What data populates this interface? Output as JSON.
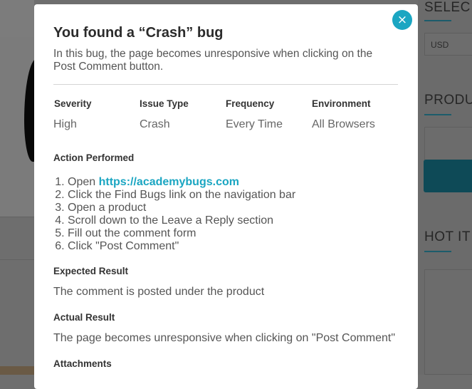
{
  "background": {
    "sidebar": {
      "select_heading": "SELEC",
      "currency_value": "USD",
      "products_heading": "PRODU",
      "hot_items_heading": "HOT IT"
    }
  },
  "modal": {
    "title": "You found a “Crash” bug",
    "description": "In this bug, the page becomes unresponsive when clicking on the Post Comment button.",
    "close_label": "×",
    "details": [
      {
        "label": "Severity",
        "value": "High"
      },
      {
        "label": "Issue Type",
        "value": "Crash"
      },
      {
        "label": "Frequency",
        "value": "Every Time"
      },
      {
        "label": "Environment",
        "value": "All Browsers"
      }
    ],
    "action_heading": "Action Performed",
    "steps": {
      "step1_prefix": "Open ",
      "step1_link": "https://academybugs.com",
      "step2": "Click the Find Bugs link on the navigation bar",
      "step3": "Open a product",
      "step4": "Scroll down to the Leave a Reply section",
      "step5": "Fill out the comment form",
      "step6": "Click \"Post Comment\""
    },
    "expected_heading": "Expected Result",
    "expected_text": "The comment is posted under the product",
    "actual_heading": "Actual Result",
    "actual_text": "The page becomes unresponsive when clicking on \"Post Comment\"",
    "attachments_heading": "Attachments"
  },
  "colors": {
    "accent": "#1ba6c2",
    "overlay_bg": "#6e6e6e",
    "modal_bg": "#ffffff"
  }
}
